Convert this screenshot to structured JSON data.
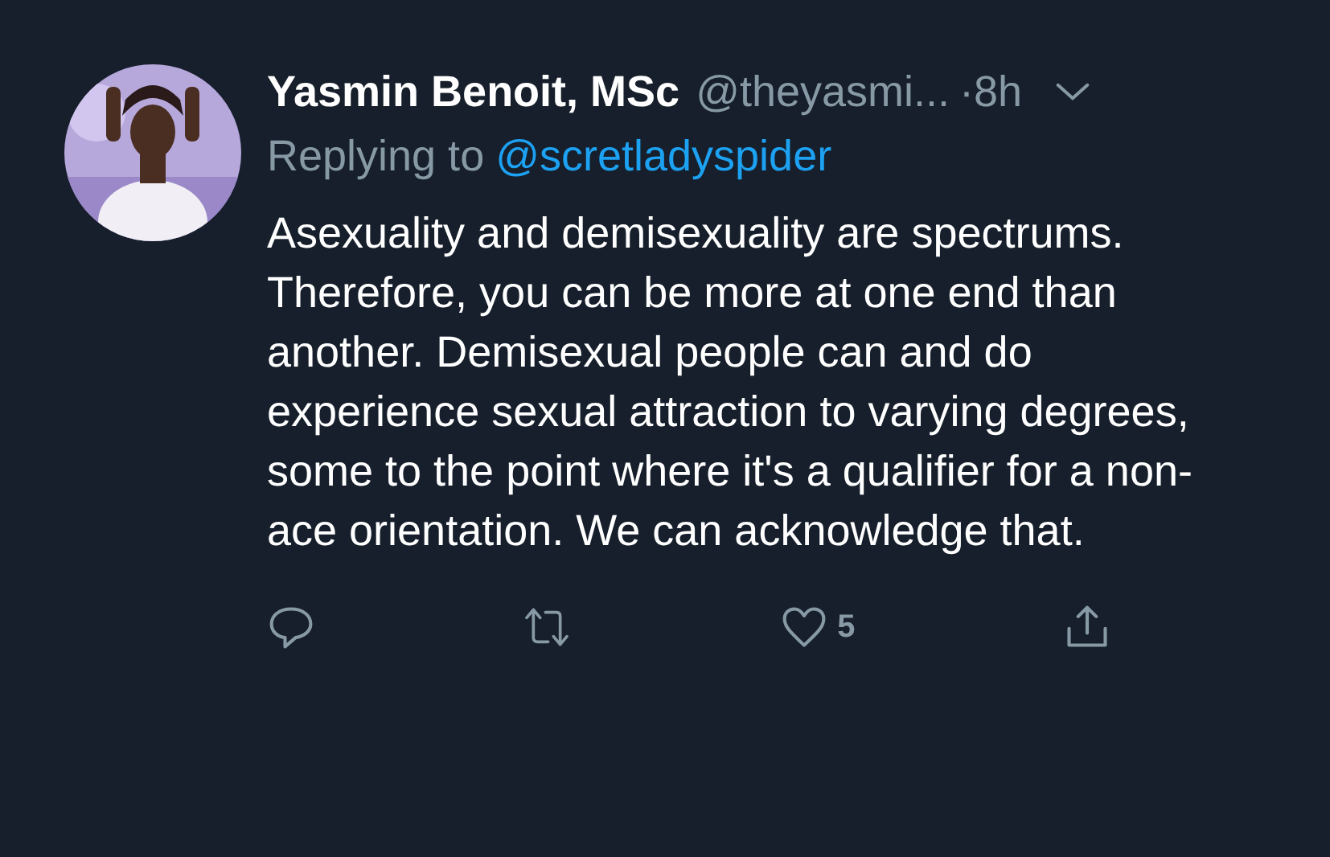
{
  "tweet": {
    "name": "Yasmin Benoit, MSc",
    "handle": "@theyasmi...",
    "time": "·8h",
    "replying_label": "Replying to",
    "replying_to": "@scretladyspider",
    "text": "Asexuality and demisexuality are spectrums. Therefore, you can be more at one end than another. Demisexual people can and do experience sexual attraction to varying degrees, some to the point where it's a qualifier for a non-ace orientation. We can acknowledge that.",
    "actions": [
      {
        "kind": "reply"
      },
      {
        "kind": "retweet"
      },
      {
        "kind": "like",
        "count": "5"
      },
      {
        "kind": "share"
      }
    ]
  }
}
